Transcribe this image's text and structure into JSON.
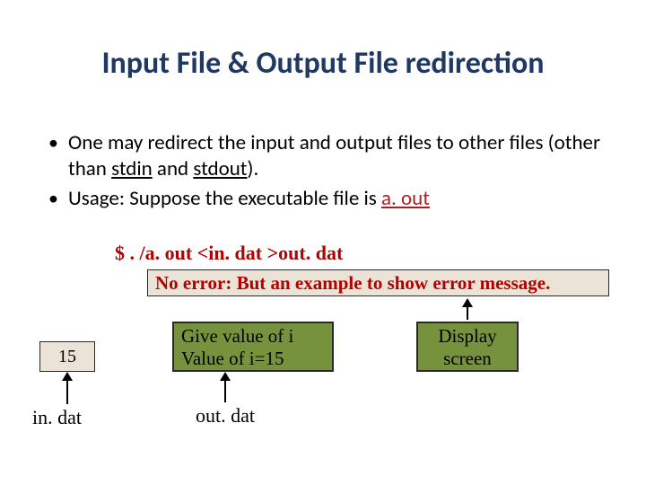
{
  "title": "Input File & Output File redirection",
  "bullets": {
    "b1_a": "One may redirect the input and output files to other files (other than ",
    "b1_u1": "stdin",
    "b1_mid": " and ",
    "b1_u2": "stdout",
    "b1_end": ").",
    "b2_a": "Usage: Suppose the executable file is ",
    "b2_aout": "a. out"
  },
  "command": "$ . /a. out  <in. dat   >out. dat",
  "errbox": "No error: But an example to show error message.",
  "box15": "15",
  "in_dat": "in. dat",
  "givebox_l1": "Give value of i",
  "givebox_l2": "Value of i=15",
  "out_dat": "out. dat",
  "display_l1": "Display",
  "display_l2": "screen"
}
